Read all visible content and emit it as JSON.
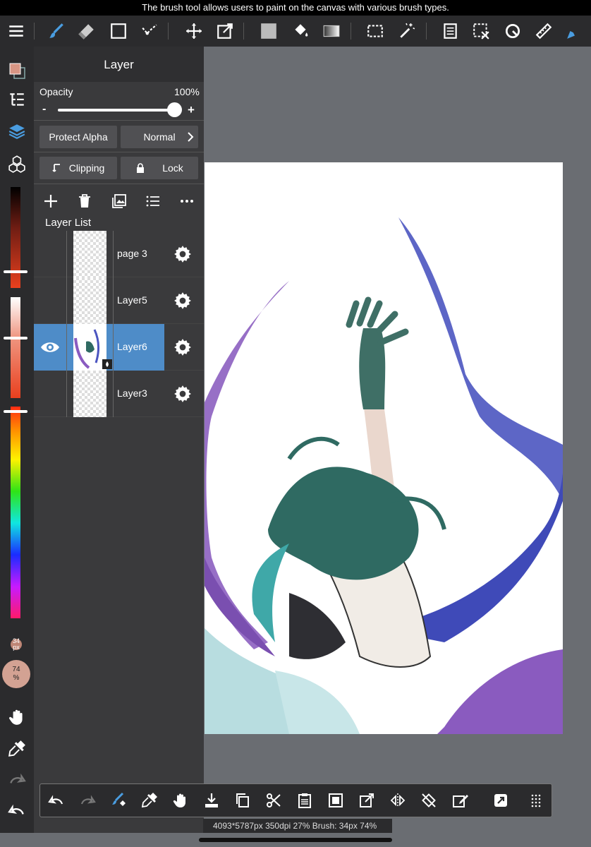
{
  "tooltip": "The brush tool allows users to paint on the canvas with various brush types.",
  "top_toolbar": {
    "icons": [
      "menu-icon",
      "brush-icon",
      "eraser-icon",
      "rectangle-icon",
      "selection-pen-icon",
      "move-icon",
      "transform-icon",
      "fill-color-icon",
      "bucket-icon",
      "gradient-icon",
      "marquee-icon",
      "magic-wand-icon",
      "layer-copy-icon",
      "deselect-icon",
      "rotate-icon",
      "ruler-icon",
      "pen-tool-icon"
    ],
    "accent": "#4a9de0"
  },
  "left_rail": {
    "main_color": "#d89684",
    "brush_size": "34\npx",
    "opacity_badge": "74\n%"
  },
  "layer_panel": {
    "title": "Layer",
    "opacity_label": "Opacity",
    "opacity_value": "100%",
    "minus": "-",
    "plus": "+",
    "protect_alpha": "Protect Alpha",
    "blend_mode": "Normal",
    "clipping": "Clipping",
    "lock": "Lock",
    "list_label": "Layer List",
    "layers": [
      {
        "name": "page 3",
        "visible": false,
        "selected": false
      },
      {
        "name": "Layer5",
        "visible": false,
        "selected": false
      },
      {
        "name": "Layer6",
        "visible": true,
        "selected": true
      },
      {
        "name": "Layer3",
        "visible": false,
        "selected": false
      }
    ]
  },
  "bottom_toolbar": {
    "icons": [
      "undo-icon",
      "redo-icon",
      "brush-erase-icon",
      "eyedropper-icon",
      "hand-icon",
      "save-icon",
      "duplicate-icon",
      "cut-icon",
      "paste-icon",
      "crop-icon",
      "export-icon",
      "flip-icon",
      "rotate-canvas-icon",
      "clear-icon",
      "snap-icon",
      "grid-icon"
    ]
  },
  "info_bar": "4093*5787px 350dpi 27% Brush: 34px 74%"
}
